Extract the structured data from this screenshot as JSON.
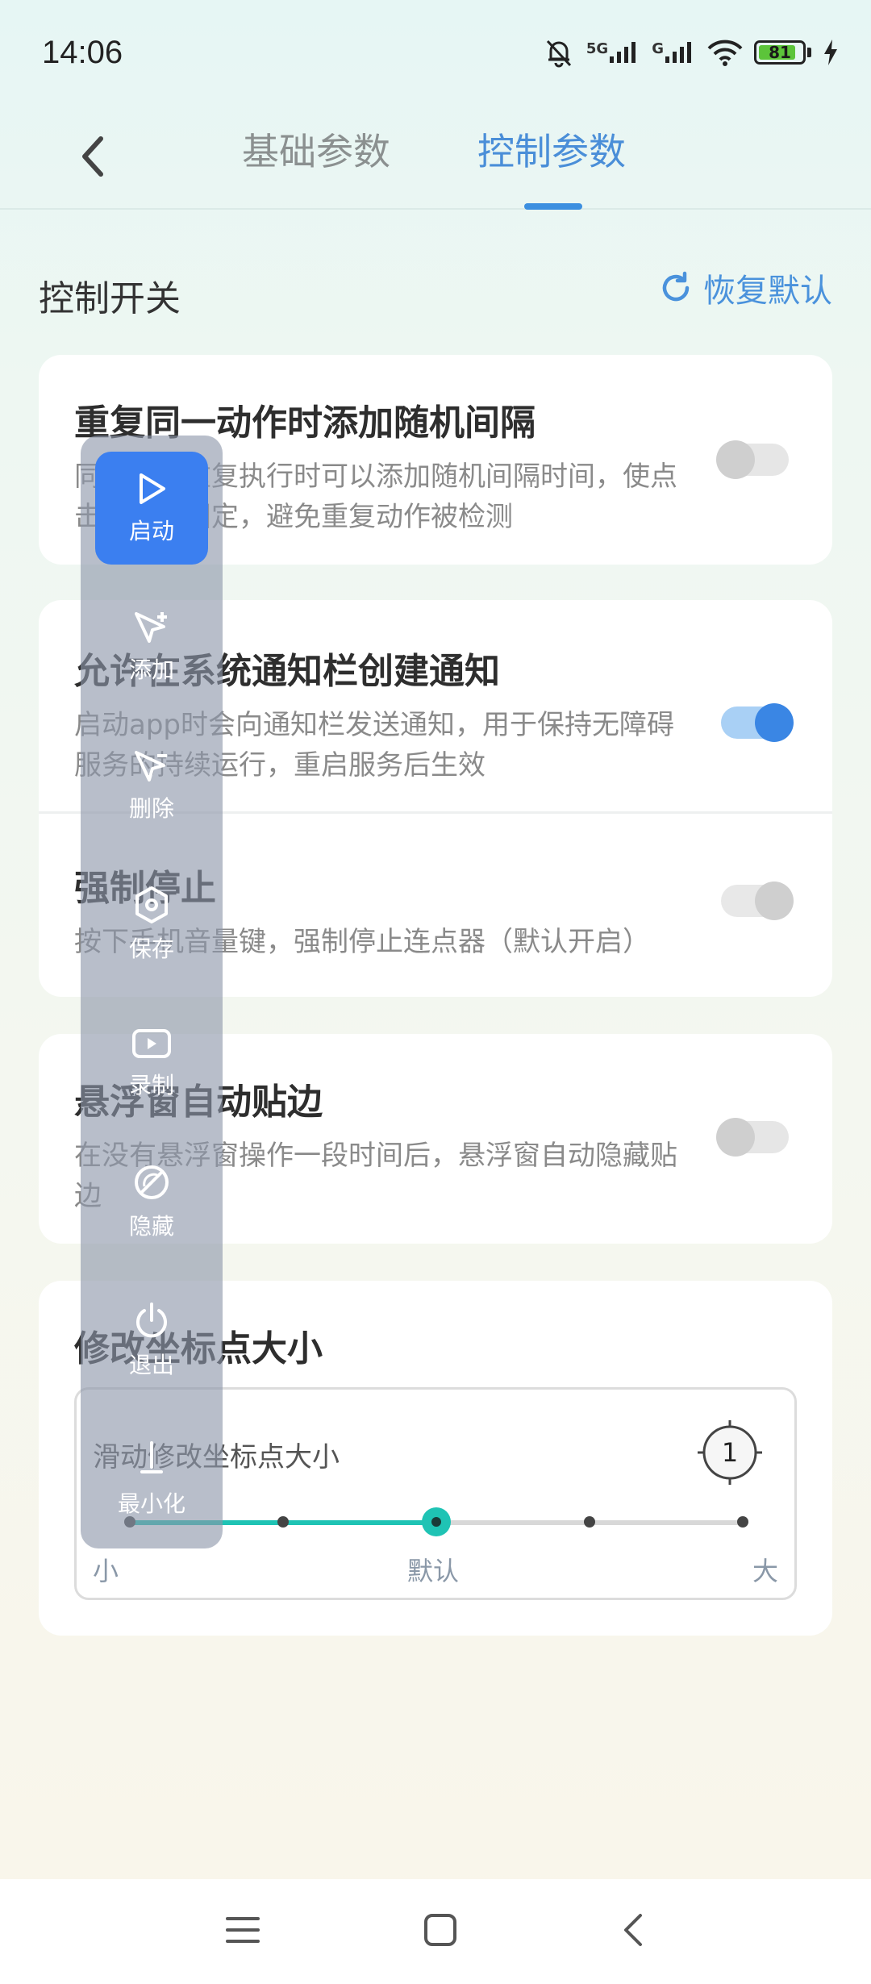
{
  "status_bar": {
    "time": "14:06",
    "network_1": "5G",
    "network_2": "G",
    "battery": "81"
  },
  "header": {
    "tabs": [
      {
        "label": "基础参数",
        "active": false
      },
      {
        "label": "控制参数",
        "active": true
      }
    ]
  },
  "section": {
    "title": "控制开关",
    "restore_label": "恢复默认"
  },
  "settings": [
    {
      "title": "重复同一动作时添加随机间隔",
      "desc": "同一动作重复执行时可以添加随机间隔时间，使点击间隔不固定，避免重复动作被检测",
      "enabled": false
    },
    {
      "title": "允许在系统通知栏创建通知",
      "desc": "启动app时会向通知栏发送通知，用于保持无障碍服务的持续运行，重启服务后生效",
      "enabled": true
    },
    {
      "title": "强制停止",
      "desc": "按下手机音量键，强制停止连点器（默认开启）",
      "enabled": true
    },
    {
      "title": "悬浮窗自动贴边",
      "desc": "在没有悬浮窗操作一段时间后，悬浮窗自动隐藏贴边",
      "enabled": false
    }
  ],
  "point_size": {
    "title": "修改坐标点大小",
    "slider_label": "滑动修改坐标点大小",
    "marker_value": "1",
    "min_label": "小",
    "default_label": "默认",
    "max_label": "大",
    "steps": 5,
    "current_step": 2
  },
  "float_toolbar": {
    "items": [
      {
        "label": "启动",
        "icon": "play-icon",
        "active": true
      },
      {
        "label": "添加",
        "icon": "add-pointer-icon",
        "active": false
      },
      {
        "label": "删除",
        "icon": "remove-pointer-icon",
        "active": false
      },
      {
        "label": "保存",
        "icon": "save-hexagon-icon",
        "active": false
      },
      {
        "label": "录制",
        "icon": "record-video-icon",
        "active": false
      },
      {
        "label": "隐藏",
        "icon": "hide-icon",
        "active": false
      },
      {
        "label": "退出",
        "icon": "power-icon",
        "active": false
      },
      {
        "label": "最小化",
        "icon": "minimize-icon",
        "active": false
      }
    ]
  },
  "colors": {
    "accent": "#3b8fe0",
    "slider": "#1fc3b4",
    "toolbar_active": "#3b7ff0"
  }
}
